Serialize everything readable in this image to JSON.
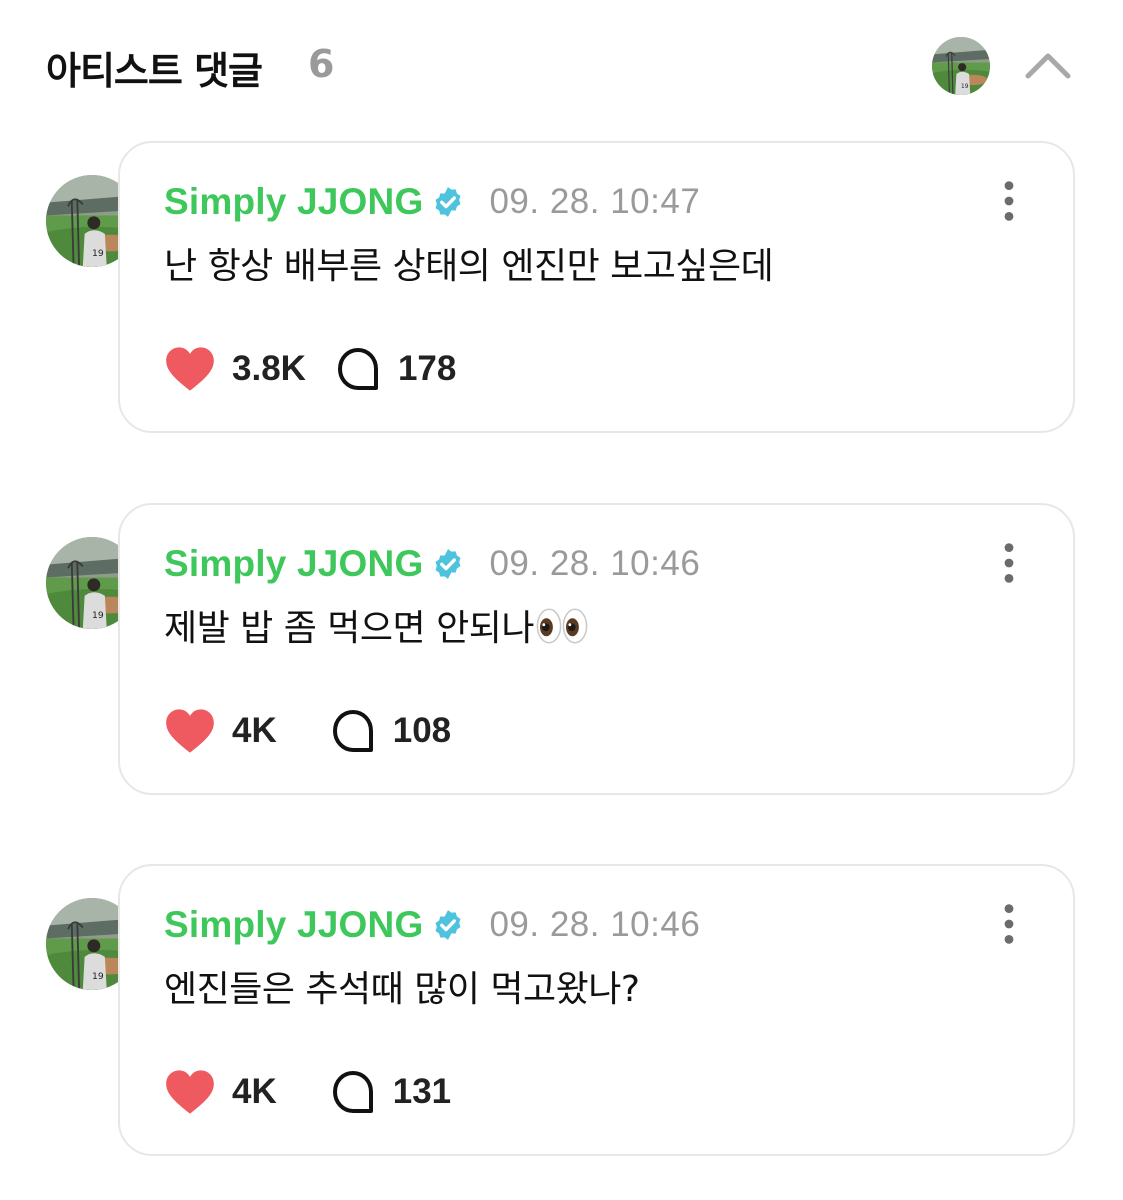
{
  "header": {
    "title": "아티스트 댓글",
    "count": "6"
  },
  "comments": [
    {
      "author": "Simply JJONG",
      "timestamp": "09. 28. 10:47",
      "text": "난 항상 배부른 상태의 엔진만 보고싶은데",
      "has_eyes_emoji": false,
      "likes": "3.8K",
      "replies": "178"
    },
    {
      "author": "Simply JJONG",
      "timestamp": "09. 28. 10:46",
      "text": "제발 밥 좀 먹으면 안되나",
      "has_eyes_emoji": true,
      "likes": "4K",
      "replies": "108"
    },
    {
      "author": "Simply JJONG",
      "timestamp": "09. 28. 10:46",
      "text": "엔진들은 추석때 많이 먹고왔나?",
      "has_eyes_emoji": false,
      "likes": "4K",
      "replies": "131"
    }
  ],
  "icons": {
    "like": "heart-icon",
    "reply": "speech-bubble-icon",
    "more": "more-vertical-icon",
    "verified": "verified-badge-icon",
    "collapse": "chevron-up-icon"
  },
  "colors": {
    "author_name": "#3ec85b",
    "verified_badge": "#4fc3dd",
    "heart": "#ee5a5f",
    "muted": "#9a9a9a",
    "card_border": "#e7e7e7"
  }
}
